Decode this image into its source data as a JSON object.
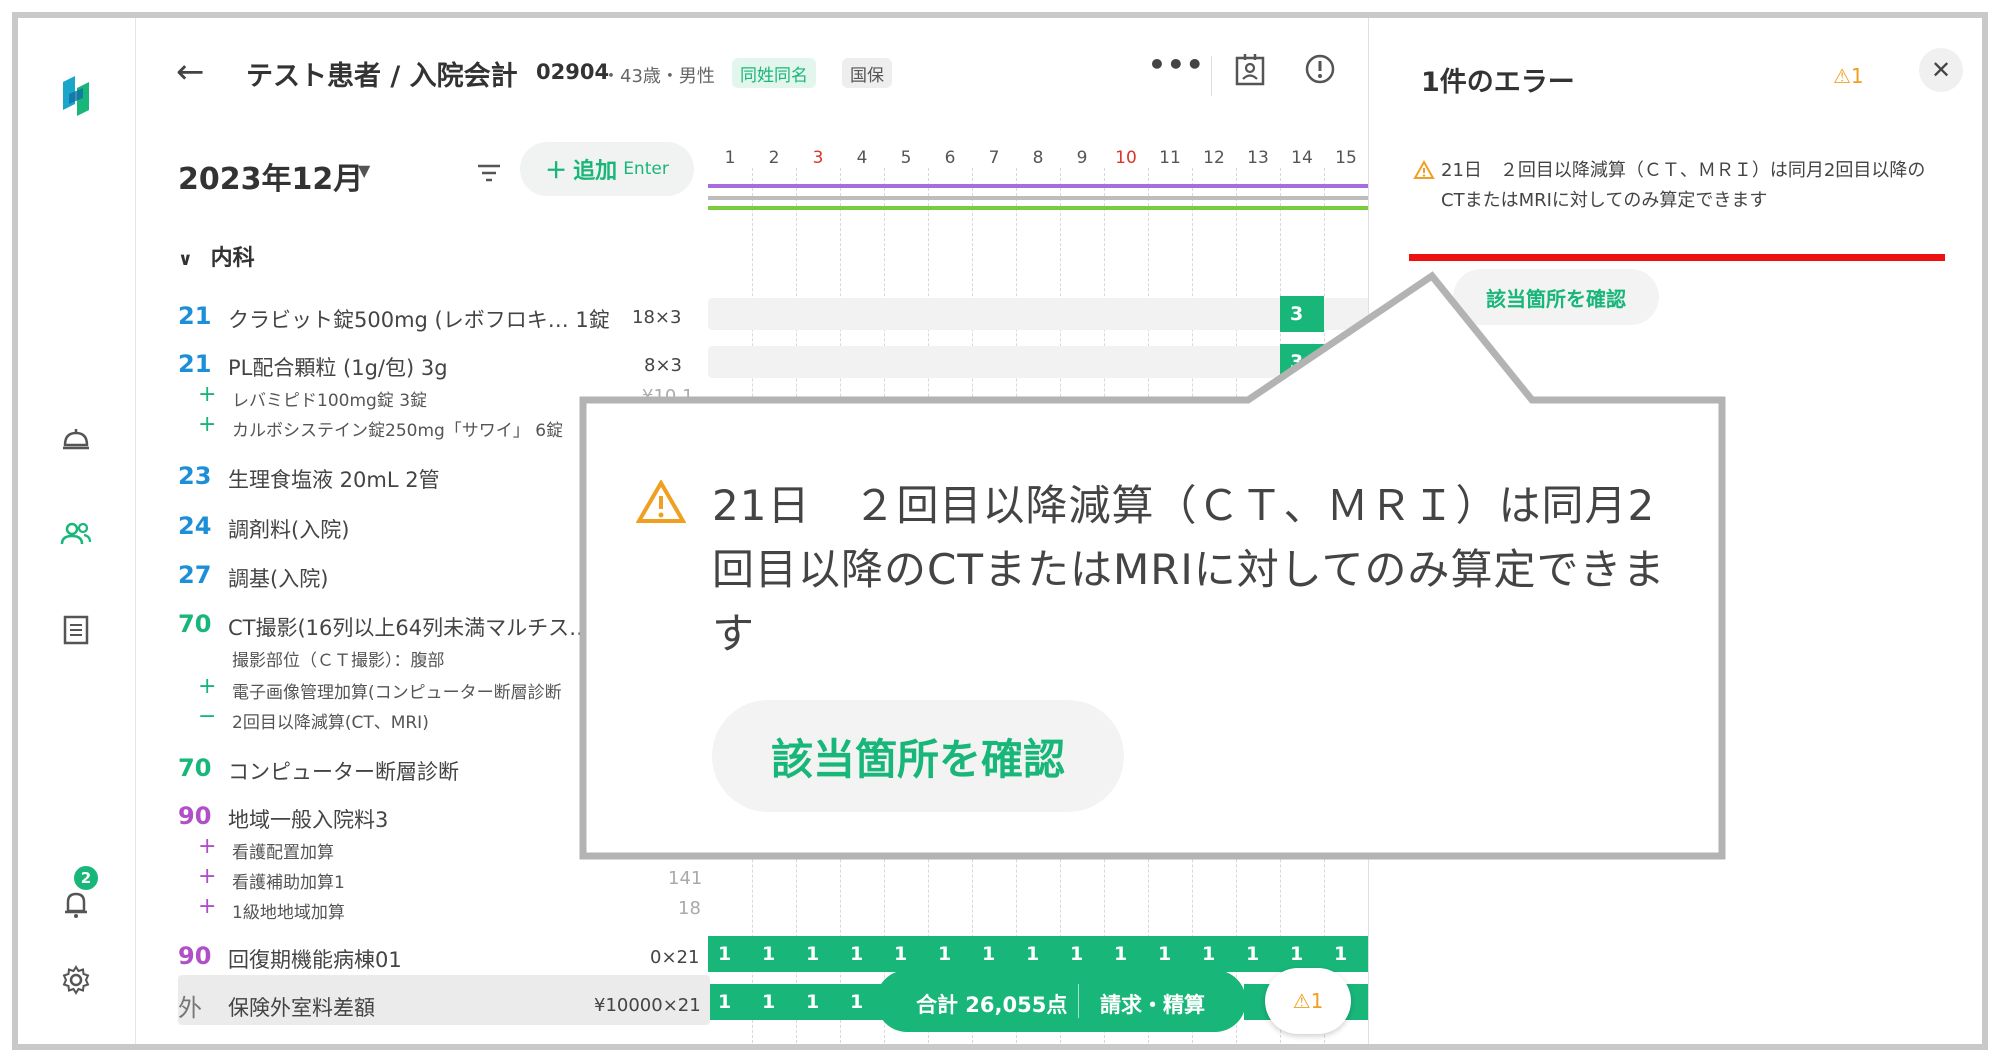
{
  "header": {
    "title": "テスト患者 / 入院会計",
    "patient_id": "02904",
    "patient_info": "・43歳・男性",
    "tags": [
      "同姓同名",
      "国保"
    ],
    "more": "•••"
  },
  "toolbar": {
    "month": "2023年12月",
    "add_label": "追加",
    "add_hint": "Enter"
  },
  "calendar": {
    "days": [
      "1",
      "2",
      "3",
      "4",
      "5",
      "6",
      "7",
      "8",
      "9",
      "10",
      "11",
      "12",
      "13",
      "14",
      "15"
    ],
    "red_days": [
      "3",
      "10"
    ],
    "line_colors": [
      "#a66ddf",
      "#bdbdbd",
      "#7ccb3e"
    ]
  },
  "list": {
    "department": "内科",
    "items": [
      {
        "code": "21",
        "name": "クラビット錠500mg (レボフロキ… 1錠",
        "qty": "18×3"
      },
      {
        "code": "21",
        "name": "PL配合顆粒 (1g/包) 3g",
        "qty": "8×3"
      },
      {
        "code": "23",
        "name": "生理食塩液 20mL 2管"
      },
      {
        "code": "24",
        "name": "調剤料(入院)"
      },
      {
        "code": "27",
        "name": "調基(入院)"
      },
      {
        "code": "70",
        "name": "CT撮影(16列以上64列未満マルチス…"
      },
      {
        "code": "70",
        "name": "コンピューター断層診断"
      },
      {
        "code": "90",
        "name": "地域一般入院料3"
      },
      {
        "code": "90",
        "name": "回復期機能病棟01",
        "qty": "0×21"
      },
      {
        "code": "外",
        "name": "保険外室料差額",
        "qty": "¥10000×21"
      }
    ],
    "subs": [
      {
        "sign": "+",
        "text": "レバミピド100mg錠 3錠",
        "price": "¥10.1"
      },
      {
        "sign": "+",
        "text": "カルボシステイン錠250mg「サワイ」 6錠"
      },
      {
        "sign": "",
        "text": "撮影部位（ＣＴ撮影）：腹部"
      },
      {
        "sign": "+",
        "text": "電子画像管理加算(コンピューター断層診断"
      },
      {
        "sign": "−",
        "text": "2回目以降減算(CT、MRI)"
      },
      {
        "sign": "+",
        "text": "看護配置加算"
      },
      {
        "sign": "+",
        "text": "看護補助加算1",
        "price": "141"
      },
      {
        "sign": "+",
        "text": "1級地地域加算",
        "price": "18"
      }
    ]
  },
  "cells": {
    "med_value": "3",
    "ward_value": "1"
  },
  "footer": {
    "total": "合計 26,055点",
    "bill": "請求・精算",
    "warn": "⚠1"
  },
  "notifications": {
    "count": "2"
  },
  "error_panel": {
    "title": "1件のエラー",
    "count": "⚠1",
    "message": "21日　２回目以降減算（ＣＴ、ＭＲＩ）は同月2回目以降のCTまたはMRIに対してのみ算定できます",
    "check_label": "該当箇所を確認"
  },
  "callout": {
    "message": "21日　２回目以降減算（ＣＴ、ＭＲＩ）は同月2回目以降のCTまたはMRIに対してのみ算定できます",
    "check_label": "該当箇所を確認"
  },
  "colors": {
    "accent": "#19b67a",
    "warning": "#f0a020",
    "error_line": "#ee1111"
  }
}
